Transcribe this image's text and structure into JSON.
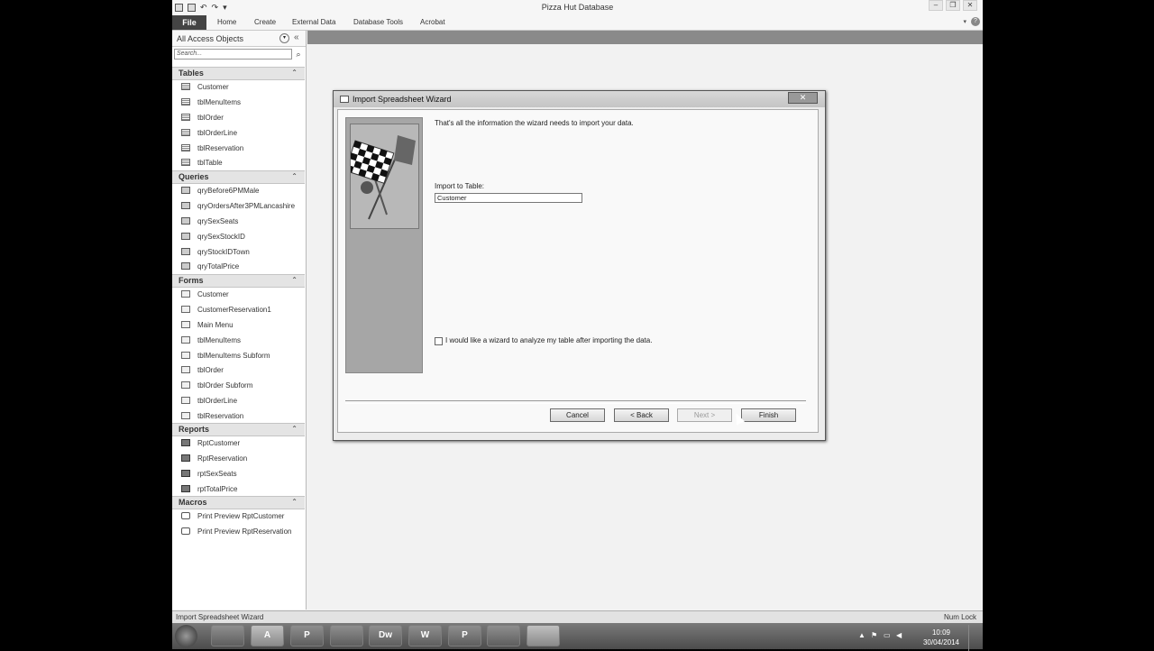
{
  "window": {
    "title": "Pizza Hut Database",
    "controls": [
      "minimize",
      "restore",
      "close"
    ]
  },
  "ribbon": {
    "file": "File",
    "tabs": [
      "Home",
      "Create",
      "External Data",
      "Database Tools",
      "Acrobat"
    ]
  },
  "nav": {
    "header": "All Access Objects",
    "search_placeholder": "Search...",
    "groups": [
      {
        "label": "Tables",
        "icon": "table-icon",
        "items": [
          "Customer",
          "tblMenuItems",
          "tblOrder",
          "tblOrderLine",
          "tblReservation",
          "tblTable"
        ]
      },
      {
        "label": "Queries",
        "icon": "query-icon",
        "items": [
          "qryBefore6PMMale",
          "qryOrdersAfter3PMLancashire",
          "qrySexSeats",
          "qrySexStockID",
          "qryStockIDTown",
          "qryTotalPrice"
        ]
      },
      {
        "label": "Forms",
        "icon": "form-icon",
        "items": [
          "Customer",
          "CustomerReservation1",
          "Main Menu",
          "tblMenuItems",
          "tblMenuItems Subform",
          "tblOrder",
          "tblOrder Subform",
          "tblOrderLine",
          "tblReservation"
        ]
      },
      {
        "label": "Reports",
        "icon": "report-icon",
        "items": [
          "RptCustomer",
          "RptReservation",
          "rptSexSeats",
          "rptTotalPrice"
        ]
      },
      {
        "label": "Macros",
        "icon": "macro-icon",
        "items": [
          "Print Preview RptCustomer",
          "Print Preview RptReservation"
        ]
      }
    ]
  },
  "dialog": {
    "title": "Import Spreadsheet Wizard",
    "message": "That's all the information the wizard needs to import your data.",
    "import_label": "Import to Table:",
    "import_value": "Customer",
    "analyze_label": "I would like a wizard to analyze my table after importing the data.",
    "analyze_checked": false,
    "buttons": {
      "cancel": "Cancel",
      "back": "< Back",
      "next": "Next >",
      "finish": "Finish"
    },
    "next_enabled": false
  },
  "statusbar": {
    "left": "Import Spreadsheet Wizard",
    "right": "Num Lock"
  },
  "taskbar": {
    "apps": [
      {
        "name": "chrome-icon",
        "label": ""
      },
      {
        "name": "access-icon",
        "label": "A"
      },
      {
        "name": "publisher-icon",
        "label": "P"
      },
      {
        "name": "file-explorer-icon",
        "label": ""
      },
      {
        "name": "dreamweaver-icon",
        "label": "Dw"
      },
      {
        "name": "word-icon",
        "label": "W"
      },
      {
        "name": "powerpoint-icon",
        "label": "P"
      },
      {
        "name": "pizza-hut-icon",
        "label": ""
      },
      {
        "name": "capture-icon",
        "label": ""
      }
    ],
    "time": "10:09",
    "date": "30/04/2014"
  }
}
